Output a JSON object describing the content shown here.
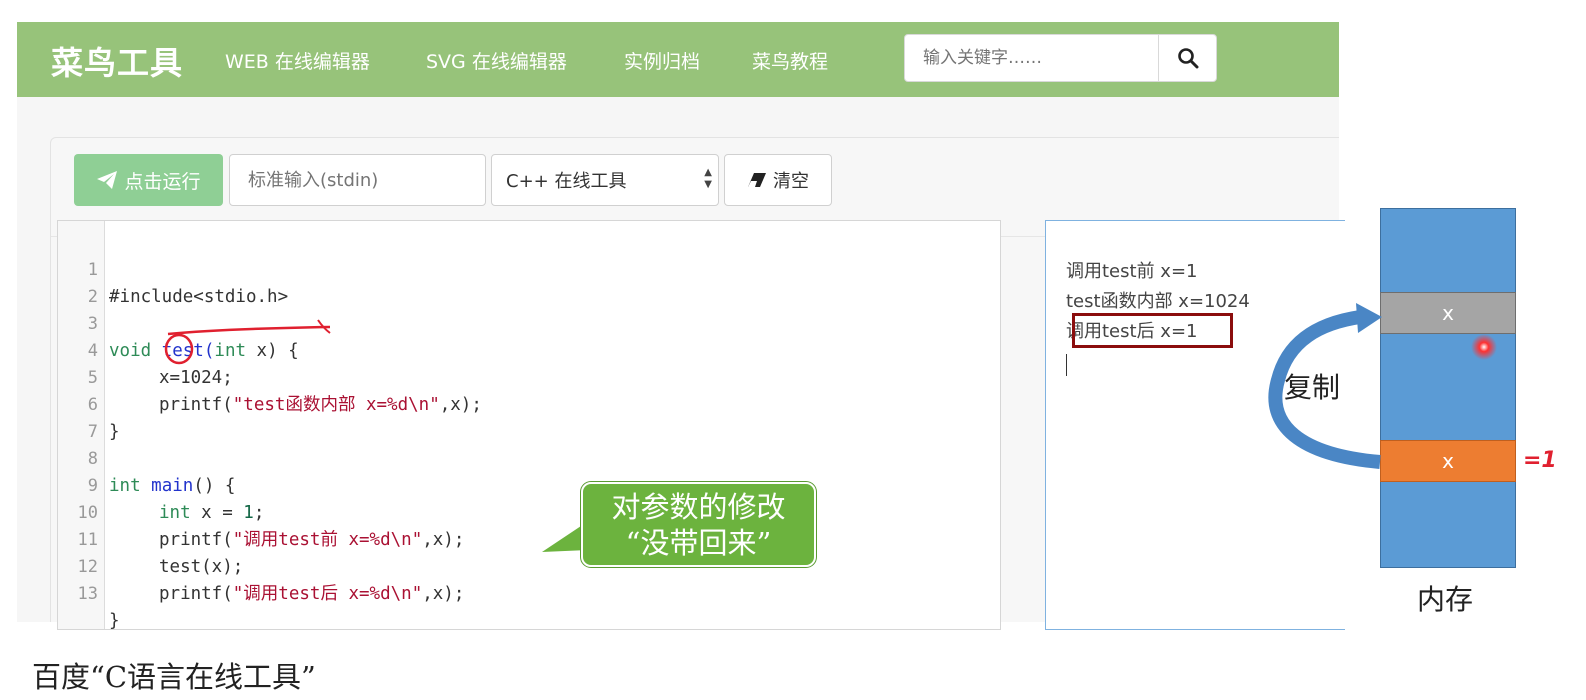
{
  "navbar": {
    "brand": "菜鸟工具",
    "links": [
      "WEB 在线编辑器",
      "SVG 在线编辑器",
      "实例归档",
      "菜鸟教程"
    ],
    "search_placeholder": "输入关键字……"
  },
  "toolbar": {
    "run_label": "点击运行",
    "stdin_placeholder": "标准输入(stdin)",
    "language_selected": "C++ 在线工具",
    "clear_label": "清空"
  },
  "editor": {
    "lines": [
      {
        "num": "1"
      },
      {
        "num": "2"
      },
      {
        "num": "3"
      },
      {
        "num": "4"
      },
      {
        "num": "5"
      },
      {
        "num": "6"
      },
      {
        "num": "7"
      },
      {
        "num": "8"
      },
      {
        "num": "9"
      },
      {
        "num": "10"
      },
      {
        "num": "11"
      },
      {
        "num": "12"
      },
      {
        "num": "13"
      }
    ],
    "code": {
      "l1": "#include<stdio.h>",
      "l3_kw": "void",
      "l3_fn": "test",
      "l3_paren_open": "(",
      "l3_type": "int",
      "l3_arg": " x",
      "l3_rest": ") {",
      "l4": "x=1024;",
      "l5_fn": "printf(",
      "l5_str": "\"test函数内部 x=%d\\n\"",
      "l5_rest": ",x);",
      "l6": "}",
      "l8_kw": "int",
      "l8_fn": "main",
      "l8_rest": "() {",
      "l9_kw": "int",
      "l9_mid": " x = ",
      "l9_num": "1",
      "l9_end": ";",
      "l10_fn": "printf(",
      "l10_str": "\"调用test前 x=%d\\n\"",
      "l10_rest": ",x);",
      "l11": "test(x);",
      "l12_fn": "printf(",
      "l12_str": "\"调用test后 x=%d\\n\"",
      "l12_rest": ",x);",
      "l13": "}"
    }
  },
  "output": {
    "lines": [
      "调用test前 x=1",
      "test函数内部 x=1024",
      "调用test后 x=1"
    ]
  },
  "annotations": {
    "callout_line1": "对参数的修改",
    "callout_line2": "“没带回来”",
    "copy_label": "复制",
    "memory_label": "内存",
    "cell_top": "x",
    "cell_bottom": "x",
    "eq_mark": "=1"
  },
  "caption": "百度“C语言在线工具”",
  "colors": {
    "navbar": "#97c37a",
    "run_button": "#8fcf95",
    "callout": "#6cb33e",
    "memory": "#5b9bd5",
    "memory_orange": "#ed7d31",
    "memory_gray": "#a5a5a5",
    "highlight": "#8b0d0d",
    "ink_red": "#e0202f"
  }
}
